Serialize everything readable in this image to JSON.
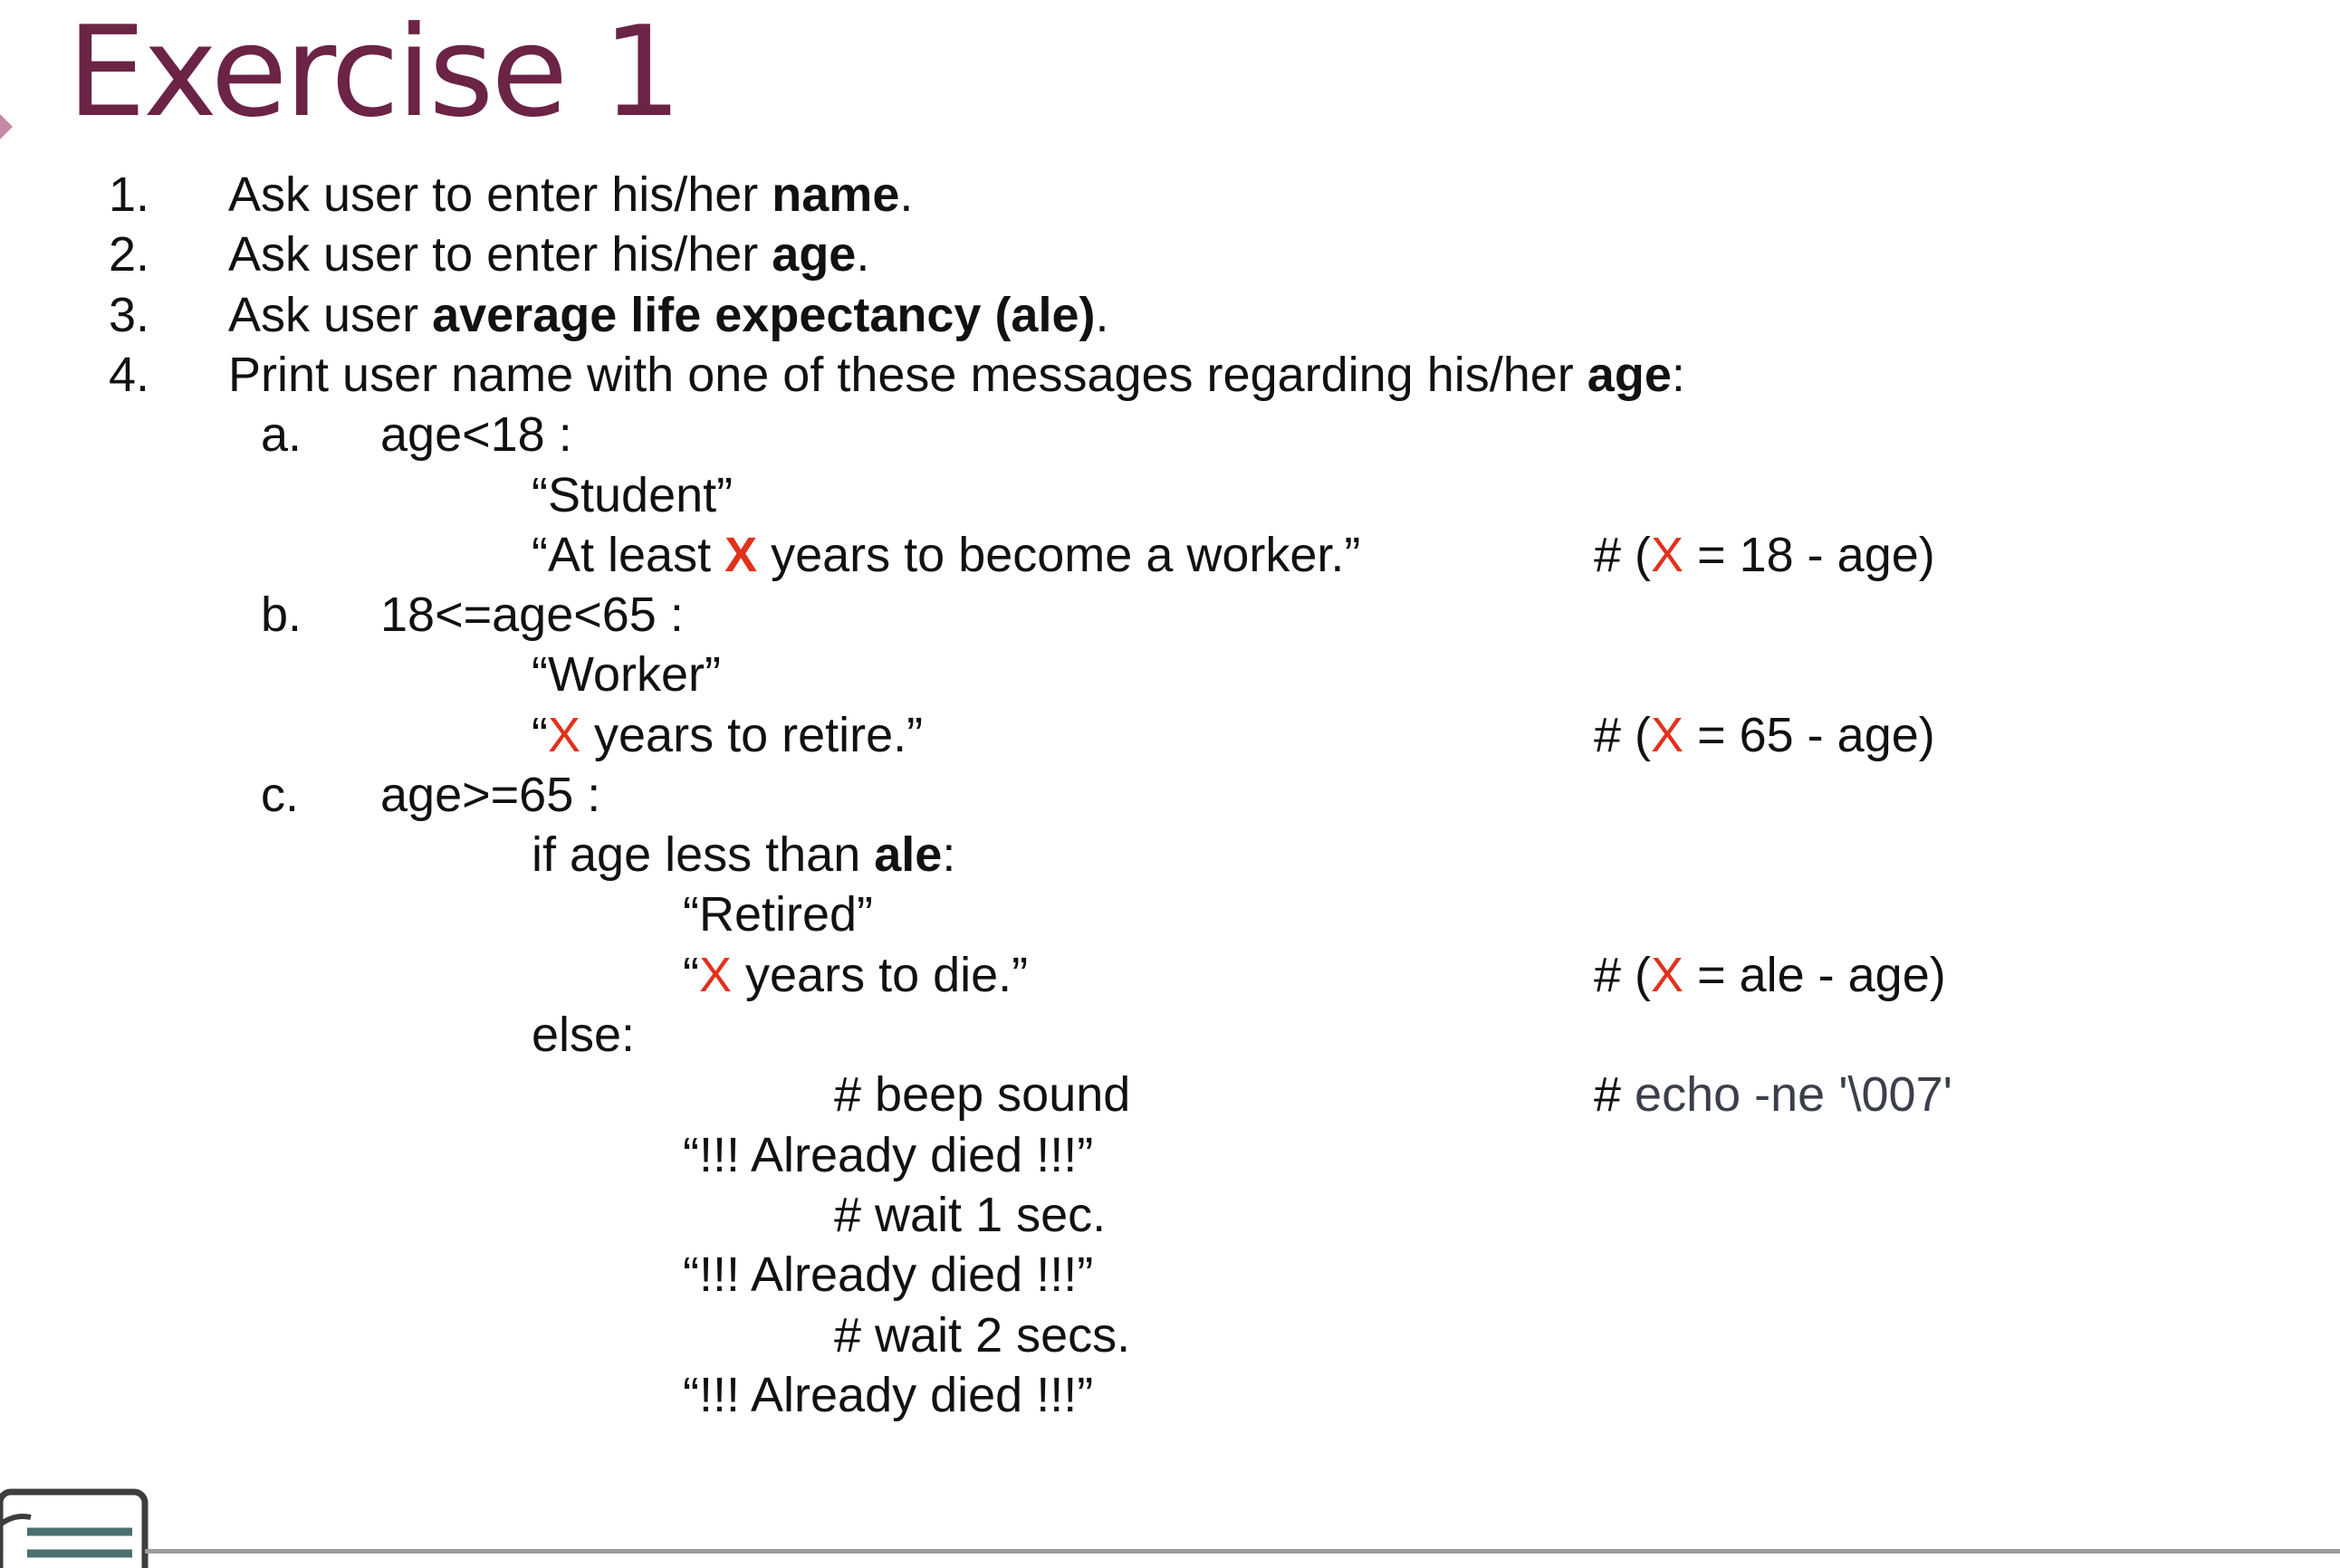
{
  "slide": {
    "title": "Exercise 1",
    "items": [
      {
        "num": "1.",
        "pre": "Ask user to enter his/her ",
        "bold": "name",
        "post": "."
      },
      {
        "num": "2.",
        "pre": "Ask user to enter his/her ",
        "bold": "age",
        "post": "."
      },
      {
        "num": "3.",
        "pre": "Ask user ",
        "bold": "average life expectancy (ale)",
        "post": "."
      },
      {
        "num": "4.",
        "pre": "Print user name with one of these messages regarding his/her ",
        "bold": "age",
        "post": ":"
      }
    ],
    "cases": {
      "a": {
        "letter": "a.",
        "condition": "age<18 :",
        "status": "“Student”",
        "msg_pre": "“At least ",
        "msg_x": "X",
        "msg_post": " years to become a worker.”",
        "comment_pre": "# (",
        "comment_x": "X",
        "comment_post": " = 18 - age)"
      },
      "b": {
        "letter": "b.",
        "condition": "18<=age<65 :",
        "status": "“Worker”",
        "msg_pre": "“",
        "msg_x": "X",
        "msg_post": " years to retire.”",
        "comment_pre": "# (",
        "comment_x": "X",
        "comment_post": " = 65 - age)"
      },
      "c": {
        "letter": "c.",
        "condition": "age>=65 :",
        "if_pre": "if age less than ",
        "if_bold": "ale",
        "if_post": ":",
        "status": "“Retired”",
        "msg_pre": "“",
        "msg_x": "X",
        "msg_post": " years to die.”",
        "comment_pre": "# (",
        "comment_x": "X",
        "comment_post": " = ale - age)",
        "else_label": "else:",
        "beep": "# beep sound",
        "echo_hash": "# ",
        "echo_cmd": "echo -ne '\\007'",
        "died": "“!!! Already died !!!”",
        "wait1": "# wait 1 sec.",
        "wait2": "# wait 2 secs."
      }
    }
  }
}
